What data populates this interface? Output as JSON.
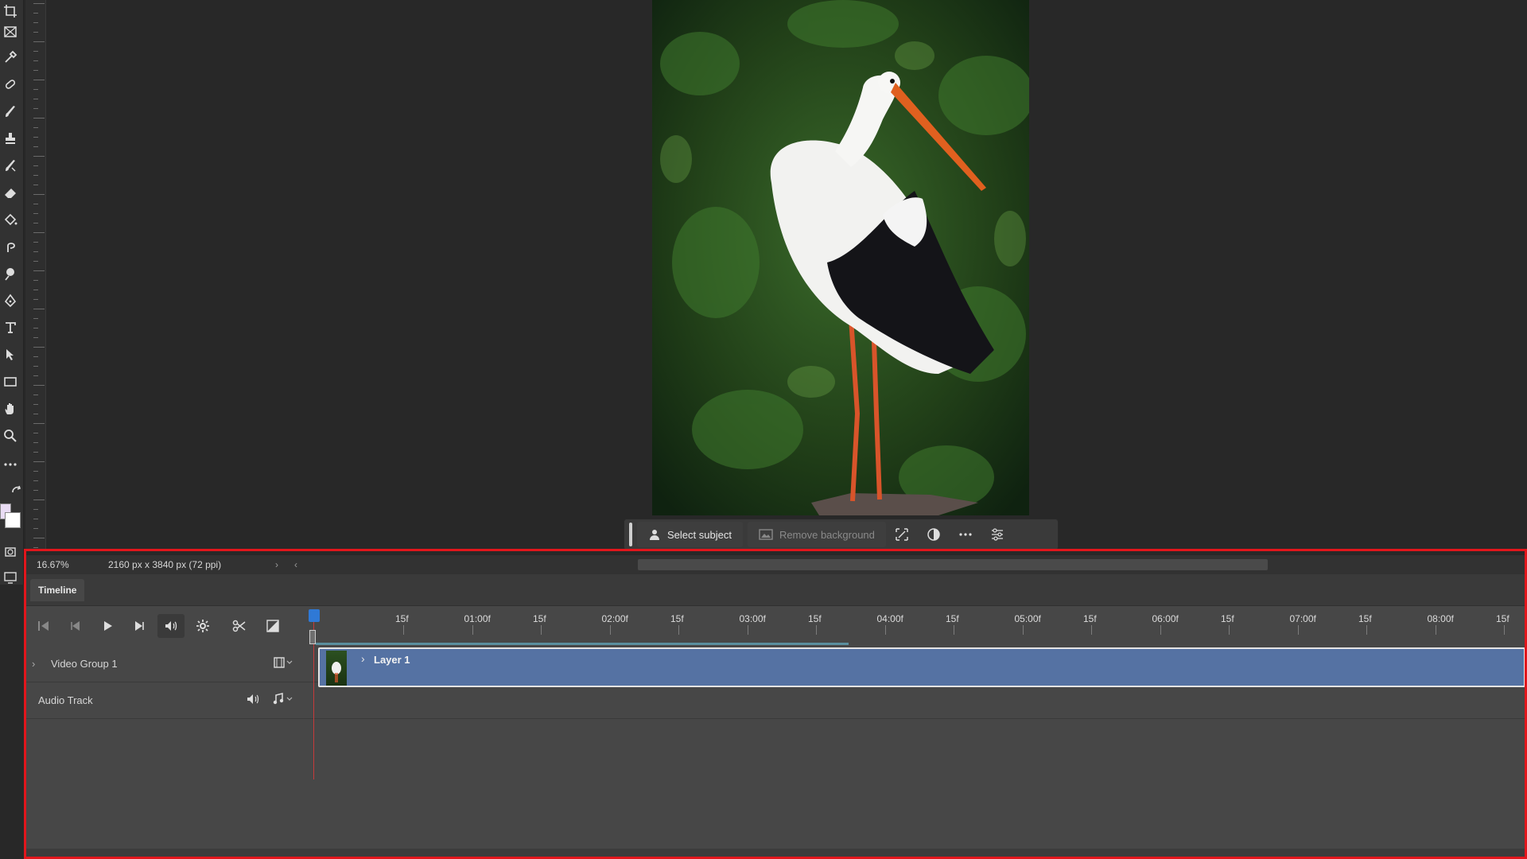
{
  "status": {
    "zoom": "16.67%",
    "doc_size": "2160 px x 3840 px (72 ppi)"
  },
  "contextual_taskbar": {
    "select_subject": "Select subject",
    "remove_background": "Remove background"
  },
  "timeline": {
    "tab_label": "Timeline",
    "ruler_labels": [
      "15f",
      "01:00f",
      "15f",
      "02:00f",
      "15f",
      "03:00f",
      "15f",
      "04:00f",
      "15f",
      "05:00f",
      "15f",
      "06:00f",
      "15f",
      "07:00f",
      "15f",
      "08:00f",
      "15f"
    ],
    "tracks": {
      "video_group": "Video Group 1",
      "audio": "Audio Track"
    },
    "clip_label": "Layer 1"
  },
  "colors": {
    "highlight": "#e2161c",
    "clip": "#5572a3",
    "playhead": "#2f79d6"
  },
  "icons": [
    "crop-icon",
    "frame-icon",
    "eyedropper-icon",
    "healing-brush-icon",
    "brush-icon",
    "clone-stamp-icon",
    "history-brush-icon",
    "eraser-icon",
    "paint-bucket-icon",
    "smudge-icon",
    "dodge-icon",
    "pen-icon",
    "type-icon",
    "path-select-icon",
    "rectangle-icon",
    "hand-icon",
    "zoom-icon",
    "more-tools-icon"
  ]
}
